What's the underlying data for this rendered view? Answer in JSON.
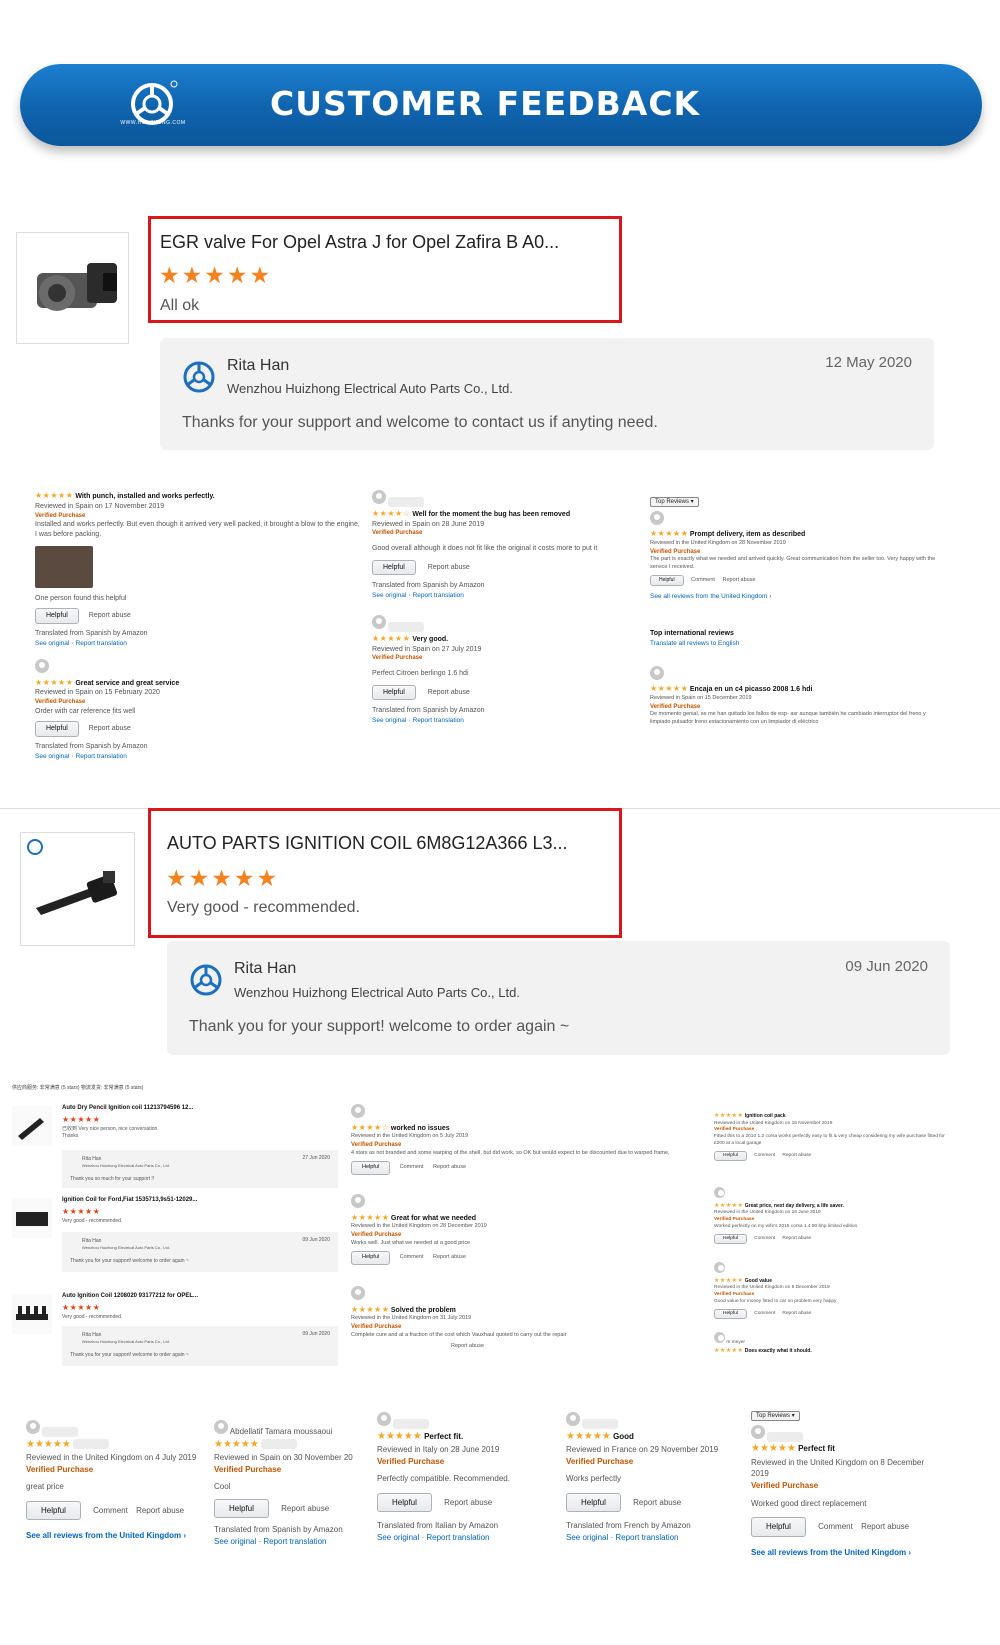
{
  "banner": {
    "title": "CUSTOMER FEEDBACK",
    "logo_text": "WWW.HUI-ZHONG.COM"
  },
  "product1": {
    "title": "EGR valve For Opel Astra J for Opel Zafira B A0...",
    "stars": "★★★★★",
    "comment": "All ok",
    "reply": {
      "name": "Rita Han",
      "company": "Wenzhou Huizhong Electrical Auto Parts Co., Ltd.",
      "text": "Thanks for your support and welcome to contact us if anyting need.",
      "date": "12 May 2020"
    }
  },
  "product2": {
    "title": "AUTO PARTS IGNITION COIL 6M8G12A366 L3...",
    "stars": "★★★★★",
    "comment": "Very good - recommended.",
    "reply": {
      "name": "Rita Han",
      "company": "Wenzhou Huizhong Electrical Auto Parts Co., Ltd.",
      "text": "Thank you for your support! welcome to order again ~",
      "date": "09 Jun 2020"
    }
  },
  "common": {
    "helpful": "Helpful",
    "report": "Report abuse",
    "comment": "Comment",
    "see_original": "See original",
    "report_translation": "Report translation",
    "verified": "Verified Purchase",
    "top_reviews": "Top Reviews"
  },
  "panel1": {
    "left": [
      {
        "stars": "★★★★★",
        "title": "With punch, installed and works perfectly.",
        "meta": "Reviewed in Spain on 17 November 2019",
        "body": "Installed and works perfectly. But even though it arrived very well packed, it brought a blow to the engine, I was before packing.",
        "helpful_note": "One person found this helpful",
        "translated": "Translated from Spanish by Amazon"
      },
      {
        "stars": "★★★★★",
        "title": "Great service and great service",
        "meta": "Reviewed in Spain on 15 February 2020",
        "body": "Order with car reference fits well",
        "translated": "Translated from Spanish by Amazon"
      }
    ],
    "middle": [
      {
        "stars": "★★★★☆",
        "title": "Well for the moment the bug has been removed",
        "meta": "Reviewed in Spain on 28 June 2019",
        "body": "Good overall although it does not fit like the original it costs more to put it",
        "translated": "Translated from Spanish by Amazon"
      },
      {
        "stars": "★★★★★",
        "title": "Very good.",
        "meta": "Reviewed in Spain on 27 July 2019",
        "body": "Perfect Citroen berlingo 1.6 hdi",
        "translated": "Translated from Spanish by Amazon"
      }
    ],
    "right": {
      "review": {
        "stars": "★★★★★",
        "title": "Prompt delivery, item as described",
        "meta": "Reviewed in the United Kingdom on 28 November 2019",
        "body": "The part is exactly what we needed and arrived quickly. Great communication from the seller too. Very happy with the service I received."
      },
      "see_all": "See all reviews from the United Kingdom ›",
      "intl_heading": "Top international reviews",
      "translate_all": "Translate all reviews to English",
      "intl_review": {
        "stars": "★★★★★",
        "title": "Encaja en un c4 picasso 2008 1.6 hdi",
        "meta": "Reviewed in Spain on 15 December 2019",
        "body": "De momento genial, se me han quitado los fallos de esp- asr aunque también he cambiado interruptor del freno y limpiado pulsador freno estacionamiento con un limpiador di eléctrico"
      }
    }
  },
  "panel2": {
    "header": "供应商服务: 非常满意 (5 stars)   物流发货: 非常满意 (5 stars)",
    "left": [
      {
        "title": "Auto Dry Pencil Ignition coil 11213794596 12...",
        "stars": "★★★★★",
        "body": "已收到 Very nice person, nice conversation.",
        "extra": "Thanks",
        "reply_name": "Rita Han",
        "reply_company": "Wenzhou Huizhong Electrical Auto Parts Co., Ltd.",
        "reply_text": "Thank you so much for your support !!",
        "reply_date": "27 Jun 2020"
      },
      {
        "title": "Ignition Coil for Ford,Fiat 1535713,9s51-12029...",
        "stars": "★★★★★",
        "body": "Very good - recommended.",
        "reply_name": "Rita Han",
        "reply_company": "Wenzhou Huizhong Electrical Auto Parts Co., Ltd.",
        "reply_text": "Thank you for your support! welcome to order again ~",
        "reply_date": "09 Jun 2020"
      },
      {
        "title": "Auto Ignition Coil 1208020 93177212 for OPEL...",
        "stars": "★★★★★",
        "body": "Very good - recommended.",
        "reply_name": "Rita Han",
        "reply_company": "Wenzhou Huizhong Electrical Auto Parts Co., Ltd.",
        "reply_text": "Thank you for your support! welcome to order again ~",
        "reply_date": "09 Jun 2020"
      }
    ],
    "middle": [
      {
        "stars": "★★★★☆",
        "title": "worked no issues",
        "meta": "Reviewed in the United Kingdom on 5 July 2019",
        "body": "4 stars as not branded and some warping of the shell, but did work, so OK but would expect to be discounted due to warped frame,"
      },
      {
        "stars": "★★★★★",
        "title": "Great for what we needed",
        "meta": "Reviewed in the United Kingdom on 28 December 2019",
        "body": "Works well. Just what we needed at a good price"
      },
      {
        "stars": "★★★★★",
        "title": "Solved the problem",
        "meta": "Reviewed in the United Kingdom on 31 July 2019",
        "body": "Complete cure and at a fraction of the cost which Vauxhaul quoted to carry out the repair"
      }
    ],
    "right": [
      {
        "stars": "★★★★★",
        "title": "Ignition coil pack",
        "meta": "Reviewed in the United Kingdom on 16 November 2019",
        "body": "Fitted this to a 2010 1.2 corsa works perfectly easy to fit & very cheap considering my wife purchase fitted for £200 at a local garage"
      },
      {
        "stars": "★★★★★",
        "title": "Great price, next day delivery, a life saver.",
        "meta": "Reviewed in the United Kingdom on 16 June 2019",
        "body": "Worked perfectly on my wife's 2015 corsa 1.4 90 bhp limited edition."
      },
      {
        "stars": "★★★★★",
        "title": "Good value",
        "meta": "Reviewed in the United Kingdom on 8 December 2019",
        "body": "Good value for money fitted to car no problem very happy"
      },
      {
        "stars": "★★★★★",
        "title": "Does exactly what it should.",
        "name": "m meyer"
      }
    ]
  },
  "bottom": [
    {
      "stars": "★★★★★",
      "meta": "Reviewed in the United Kingdom on 4 July 2019",
      "body": "great price",
      "see_all": "See all reviews from the United Kingdom ›"
    },
    {
      "name": "Abdellatif Tamara moussaoui",
      "stars": "★★★★★",
      "meta": "Reviewed in Spain on 30 November 20",
      "body": "Cool",
      "translated": "Translated from Spanish by Amazon"
    },
    {
      "stars": "★★★★★",
      "title": "Perfect fit.",
      "meta": "Reviewed in Italy on 28 June 2019",
      "body": "Perfectly compatible. Recommended.",
      "translated": "Translated from Italian by Amazon"
    },
    {
      "stars": "★★★★★",
      "title": "Good",
      "meta": "Reviewed in France on 29 November 2019",
      "body": "Works perfectly",
      "translated": "Translated from French by Amazon"
    },
    {
      "stars": "★★★★★",
      "title": "Perfect fit",
      "meta": "Reviewed in the United Kingdom on 8 December 2019",
      "body": "Worked good direct replacement",
      "see_all": "See all reviews from the United Kingdom ›"
    }
  ],
  "colors": {
    "banner": "#0f63ad",
    "accent_red": "#d9161a",
    "star_orange": "#f5821f",
    "link": "#0066c0",
    "verified": "#c45500"
  }
}
